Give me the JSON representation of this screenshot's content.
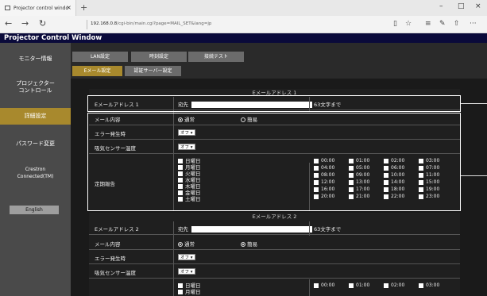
{
  "browser": {
    "tab_title": "Projector control windo",
    "url_host": "192.168.0.8",
    "url_path": "/cgi-bin/main.cgi?page=MAIL_SET&lang=jp",
    "new_tab": "+",
    "close": "×",
    "minimize": "–",
    "maximize": "□",
    "window_close": "×"
  },
  "header": {
    "title": "Projector Control Window"
  },
  "sidebar": {
    "items": [
      {
        "label": "モニター情報"
      },
      {
        "label": "プロジェクター\nコントロール"
      },
      {
        "label": "詳細設定"
      },
      {
        "label": "パスワード変更"
      },
      {
        "label": "Crestron\nConnected(TM)"
      }
    ],
    "lang_button": "English"
  },
  "topnav": {
    "row1": [
      "LAN設定",
      "時刻設定",
      "接続テスト"
    ],
    "row2": [
      "Eメール設定",
      "認証サーバー設定"
    ]
  },
  "section1": {
    "title": "Eメールアドレス 1",
    "email_label": "Eメールアドレス 1",
    "to_label": "宛先",
    "limit": "63文字まで",
    "content_label": "メール内容",
    "opt_normal": "通常",
    "opt_simple": "簡易",
    "error_label": "エラー発生時",
    "error_value": "オフ",
    "intake_label": "吸気センサー温度",
    "intake_value": "オフ",
    "report_label": "定期報告",
    "days": [
      "日曜日",
      "月曜日",
      "火曜日",
      "水曜日",
      "木曜日",
      "金曜日",
      "土曜日"
    ],
    "hours": [
      "00:00",
      "01:00",
      "02:00",
      "03:00",
      "04:00",
      "05:00",
      "06:00",
      "07:00",
      "08:00",
      "09:00",
      "10:00",
      "11:00",
      "12:00",
      "13:00",
      "14:00",
      "15:00",
      "16:00",
      "17:00",
      "18:00",
      "19:00",
      "20:00",
      "21:00",
      "22:00",
      "23:00"
    ]
  },
  "section2": {
    "title": "Eメールアドレス 2",
    "email_label": "Eメールアドレス 2",
    "to_label": "宛先",
    "limit": "63文字まで",
    "content_label": "メール内容",
    "opt_normal": "通常",
    "opt_simple": "簡易",
    "error_label": "エラー発生時",
    "error_value": "オフ",
    "intake_label": "吸気センサー温度",
    "intake_value": "オフ",
    "days_visible": [
      "日曜日",
      "月曜日"
    ],
    "hours_visible": [
      "00:00",
      "01:00",
      "02:00",
      "03:00"
    ]
  },
  "icons": {
    "back": "←",
    "forward": "→",
    "refresh": "↻",
    "reading": "▯",
    "favorite": "☆",
    "hub": "≡",
    "note": "✎",
    "share": "⇧",
    "more": "···"
  }
}
